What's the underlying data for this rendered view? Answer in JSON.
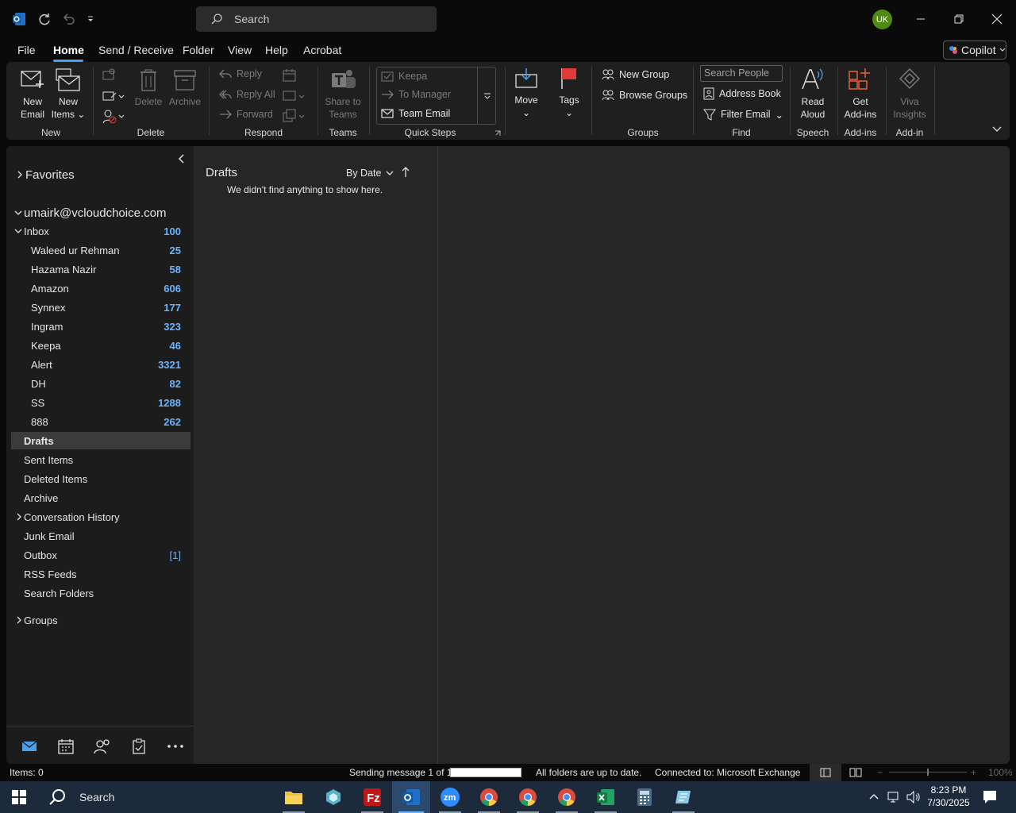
{
  "titlebar": {
    "search_placeholder": "Search",
    "avatar_initials": "UK"
  },
  "menu": {
    "tabs": [
      "File",
      "Home",
      "Send / Receive",
      "Folder",
      "View",
      "Help",
      "Acrobat"
    ],
    "active": "Home",
    "copilot_label": "Copilot"
  },
  "ribbon": {
    "new_email": [
      "New",
      "Email"
    ],
    "new_items": [
      "New",
      "Items"
    ],
    "delete": "Delete",
    "archive": "Archive",
    "reply": "Reply",
    "reply_all": "Reply All",
    "forward": "Forward",
    "share_teams": [
      "Share to",
      "Teams"
    ],
    "quick_steps": [
      "Keepa",
      "To Manager",
      "Team Email"
    ],
    "move": "Move",
    "tags": "Tags",
    "new_group": "New Group",
    "browse_groups": "Browse Groups",
    "search_people_placeholder": "Search People",
    "address_book": "Address Book",
    "filter_email": "Filter Email",
    "read_aloud": [
      "Read",
      "Aloud"
    ],
    "get_addins": [
      "Get",
      "Add-ins"
    ],
    "viva_insights": [
      "Viva",
      "Insights"
    ],
    "group_labels": {
      "new": "New",
      "delete": "Delete",
      "respond": "Respond",
      "teams": "Teams",
      "quick_steps": "Quick Steps",
      "groups": "Groups",
      "find": "Find",
      "speech": "Speech",
      "addins": "Add-ins",
      "addin": "Add-in"
    }
  },
  "nav": {
    "favorites": "Favorites",
    "account": "umairk@vcloudchoice.com",
    "inbox": {
      "name": "Inbox",
      "count": "100"
    },
    "subfolders": [
      {
        "name": "Waleed ur Rehman",
        "count": "25"
      },
      {
        "name": "Hazama Nazir",
        "count": "58"
      },
      {
        "name": "Amazon",
        "count": "606"
      },
      {
        "name": "Synnex",
        "count": "177"
      },
      {
        "name": "Ingram",
        "count": "323"
      },
      {
        "name": "Keepa",
        "count": "46"
      },
      {
        "name": "Alert",
        "count": "3321"
      },
      {
        "name": "DH",
        "count": "82"
      },
      {
        "name": "SS",
        "count": "1288"
      },
      {
        "name": "888",
        "count": "262"
      }
    ],
    "folders": [
      "Drafts",
      "Sent Items",
      "Deleted Items",
      "Archive",
      "Conversation History",
      "Junk Email",
      "Outbox",
      "RSS Feeds",
      "Search Folders"
    ],
    "outbox_count": "[1]",
    "groups": "Groups",
    "selected": "Drafts"
  },
  "list": {
    "title": "Drafts",
    "sort": "By Date",
    "empty_message": "We didn't find anything to show here."
  },
  "status": {
    "items": "Items: 0",
    "sending": "Sending message 1 of 1",
    "up_to_date": "All folders are up to date.",
    "connected": "Connected to: Microsoft Exchange",
    "zoom": "100%"
  },
  "taskbar": {
    "search": "Search",
    "time": "8:23 PM",
    "date": "7/30/2025"
  },
  "colors": {
    "accent": "#4aa0f0",
    "count": "#6ab4ff",
    "avatar": "#4e8a14"
  }
}
